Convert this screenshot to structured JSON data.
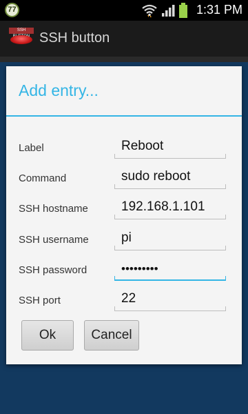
{
  "status_bar": {
    "notification_count": "77",
    "time": "1:31 PM",
    "icons": [
      "wifi-icon",
      "signal-icon",
      "battery-icon"
    ]
  },
  "action_bar": {
    "icon_label": "SSH BUTTON",
    "title": "SSH button"
  },
  "dialog": {
    "title": "Add entry...",
    "accent_color": "#33b5e5",
    "fields": [
      {
        "label": "Label",
        "value": "Reboot"
      },
      {
        "label": "Command",
        "value": "sudo reboot"
      },
      {
        "label": "SSH hostname",
        "value": "192.168.1.101"
      },
      {
        "label": "SSH username",
        "value": "pi"
      },
      {
        "label": "SSH password",
        "value": "•••••••••",
        "focused": true
      },
      {
        "label": "SSH port",
        "value": "22"
      }
    ],
    "buttons": {
      "ok": "Ok",
      "cancel": "Cancel"
    }
  }
}
